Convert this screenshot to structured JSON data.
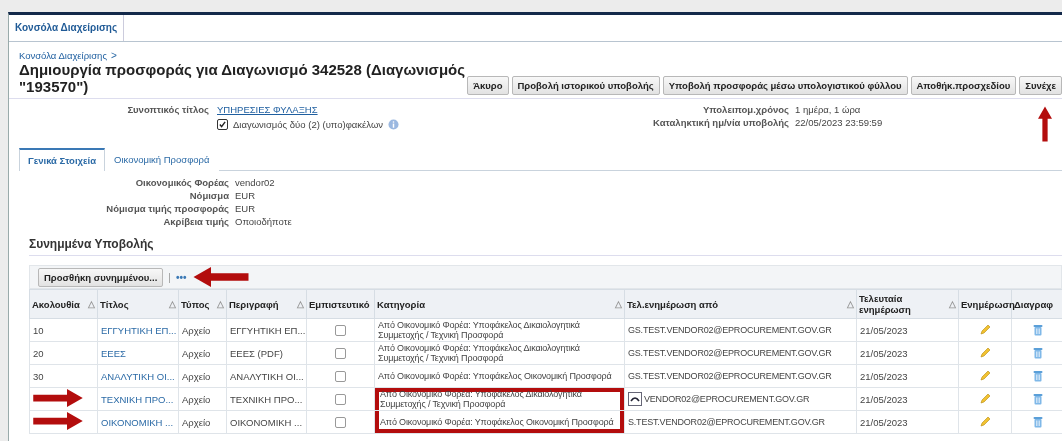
{
  "top_tabs": [
    {
      "label": "Κονσόλα Διαχείρισης",
      "selected": true
    }
  ],
  "breadcrumb": {
    "link": "Κονσόλα Διαχείρισης",
    "separator": ">"
  },
  "title": "Δημιουργία προσφοράς για Διαγωνισμό 342528 (Διαγωνισμός \"193570\")",
  "buttons": [
    "Άκυρο",
    "Προβολή ιστορικού υποβολής",
    "Υποβολή προσφοράς μέσω υπολογιστικού φύλλου",
    "Αποθήκ.προσχεδίου",
    "Συνέχε"
  ],
  "summary": {
    "label": "Συνοπτικός τίτλος",
    "value": "ΥΠΗΡΕΣΙΕΣ ΦΥΛΑΞΗΣ",
    "checkbox": {
      "label": "Διαγωνισμός δύο (2) (υπο)φακέλων",
      "checked": true
    }
  },
  "deadline": [
    {
      "label": "Υπολειπομ.χρόνος",
      "value": "1 ημέρα, 1 ώρα"
    },
    {
      "label": "Καταληκτική ημ/νία υποβολής",
      "value": "22/05/2023 23:59:59"
    }
  ],
  "tabs": [
    {
      "label": "Γενικά Στοιχεία",
      "selected": true
    },
    {
      "label": "Οικονομική Προσφορά",
      "selected": false
    }
  ],
  "fields": [
    {
      "label": "Οικονομικός Φορέας",
      "value": "vendor02"
    },
    {
      "label": "Νόμισμα",
      "value": "EUR"
    },
    {
      "label": "Νόμισμα τιμής προσφοράς",
      "value": "EUR"
    },
    {
      "label": "Ακρίβεια τιμής",
      "value": "Οποιοδήποτε"
    }
  ],
  "section_title": "Συνημμένα Υποβολής",
  "toolbar": {
    "add_button": "Προσθήκη συνημμένου...",
    "separator": "|",
    "more": "•••"
  },
  "table": {
    "columns": [
      {
        "label": "Ακολουθία",
        "sort_icon": "△"
      },
      {
        "label": "Τίτλος",
        "sort_icon": "△"
      },
      {
        "label": "Τύπος",
        "sort_icon": "△"
      },
      {
        "label": "Περιγραφή",
        "sort_icon": "△"
      },
      {
        "label": "Εμπιστευτικό"
      },
      {
        "label": "Κατηγορία",
        "sort_icon": "△"
      },
      {
        "label": "Τελ.ενημέρωση από",
        "sort_icon": "△"
      },
      {
        "label": "Τελευταία ενημέρωση",
        "sort_icon": "△"
      },
      {
        "label": "Ενημέρωση"
      },
      {
        "label": "Διαγραφ"
      }
    ],
    "rows": [
      {
        "sequence": "10",
        "title": "ΕΓΓΥΗΤΙΚΗ ΕΠ...",
        "type": "Αρχείο",
        "description": "ΕΓΓΥΗΤΙΚΗ ΕΠ...",
        "confidential": false,
        "category": "Από Οικονομικό Φορέα: Υποφάκελος Δικαιολογητικά Συμμετοχής / Τεχνική Προσφορά",
        "updated_by": "GS.TEST.VENDOR02@EPROCUREMENT.GOV.GR",
        "updated": "21/05/2023",
        "arrow": false,
        "boxed": false
      },
      {
        "sequence": "20",
        "title": "ΕΕΕΣ",
        "type": "Αρχείο",
        "description": "ΕΕΕΣ (PDF)",
        "confidential": false,
        "category": "Από Οικονομικό Φορέα: Υποφάκελος Δικαιολογητικά Συμμετοχής / Τεχνική Προσφορά",
        "updated_by": "GS.TEST.VENDOR02@EPROCUREMENT.GOV.GR",
        "updated": "21/05/2023",
        "arrow": false,
        "boxed": false
      },
      {
        "sequence": "30",
        "title": "ΑΝΑΛΥΤΙΚΗ ΟΙ...",
        "type": "Αρχείο",
        "description": "ΑΝΑΛΥΤΙΚΗ ΟΙ...",
        "confidential": false,
        "category": "Από Οικονομικό Φορέα: Υποφάκελος Οικονομική Προσφορά",
        "updated_by": "GS.TEST.VENDOR02@EPROCUREMENT.GOV.GR",
        "updated": "21/05/2023",
        "arrow": false,
        "boxed": false
      },
      {
        "title": "ΤΕΧΝΙΚΗ ΠΡΟ...",
        "type": "Αρχείο",
        "description": "ΤΕΧΝΙΚΗ ΠΡΟ...",
        "confidential": false,
        "category": "Από Οικονομικό Φορέα: Υποφάκελος Δικαιολογητικά Συμμετοχής / Τεχνική Προσφορά",
        "updated_by": "VENDOR02@EPROCUREMENT.GOV.GR",
        "updated": "21/05/2023",
        "arrow": true,
        "boxed": true
      },
      {
        "title": "ΟΙΚΟΝΟΜΙΚΗ ...",
        "type": "Αρχείο",
        "description": "ΟΙΚΟΝΟΜΙΚΗ ...",
        "confidential": false,
        "category": "Από Οικονομικό Φορέα: Υποφάκελος Οικονομική Προσφορά",
        "updated_by": "S.TEST.VENDOR02@EPROCUREMENT.GOV.GR",
        "updated": "21/05/2023",
        "arrow": true,
        "boxed": true
      }
    ]
  }
}
